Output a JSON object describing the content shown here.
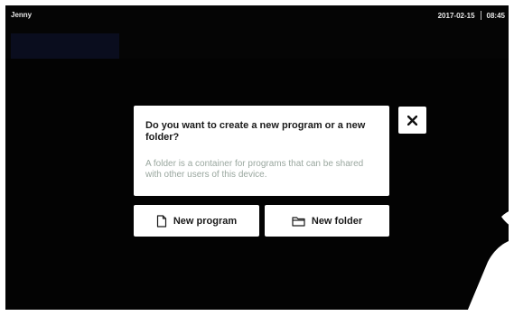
{
  "topbar": {
    "user": "Jenny",
    "date": "2017-02-15",
    "time": "08:45"
  },
  "dialog": {
    "question": "Do you want to create a new program or a new folder?",
    "description": "A folder is a container for programs that can be shared with other users of this device.",
    "close_icon": "close-icon"
  },
  "buttons": {
    "new_program": {
      "label": "New program",
      "icon": "document-icon"
    },
    "new_folder": {
      "label": "New folder",
      "icon": "folder-icon"
    }
  },
  "colors": {
    "screen_bg": "#050505",
    "dialog_bg": "#ffffff",
    "description_text": "#9aa79f"
  }
}
